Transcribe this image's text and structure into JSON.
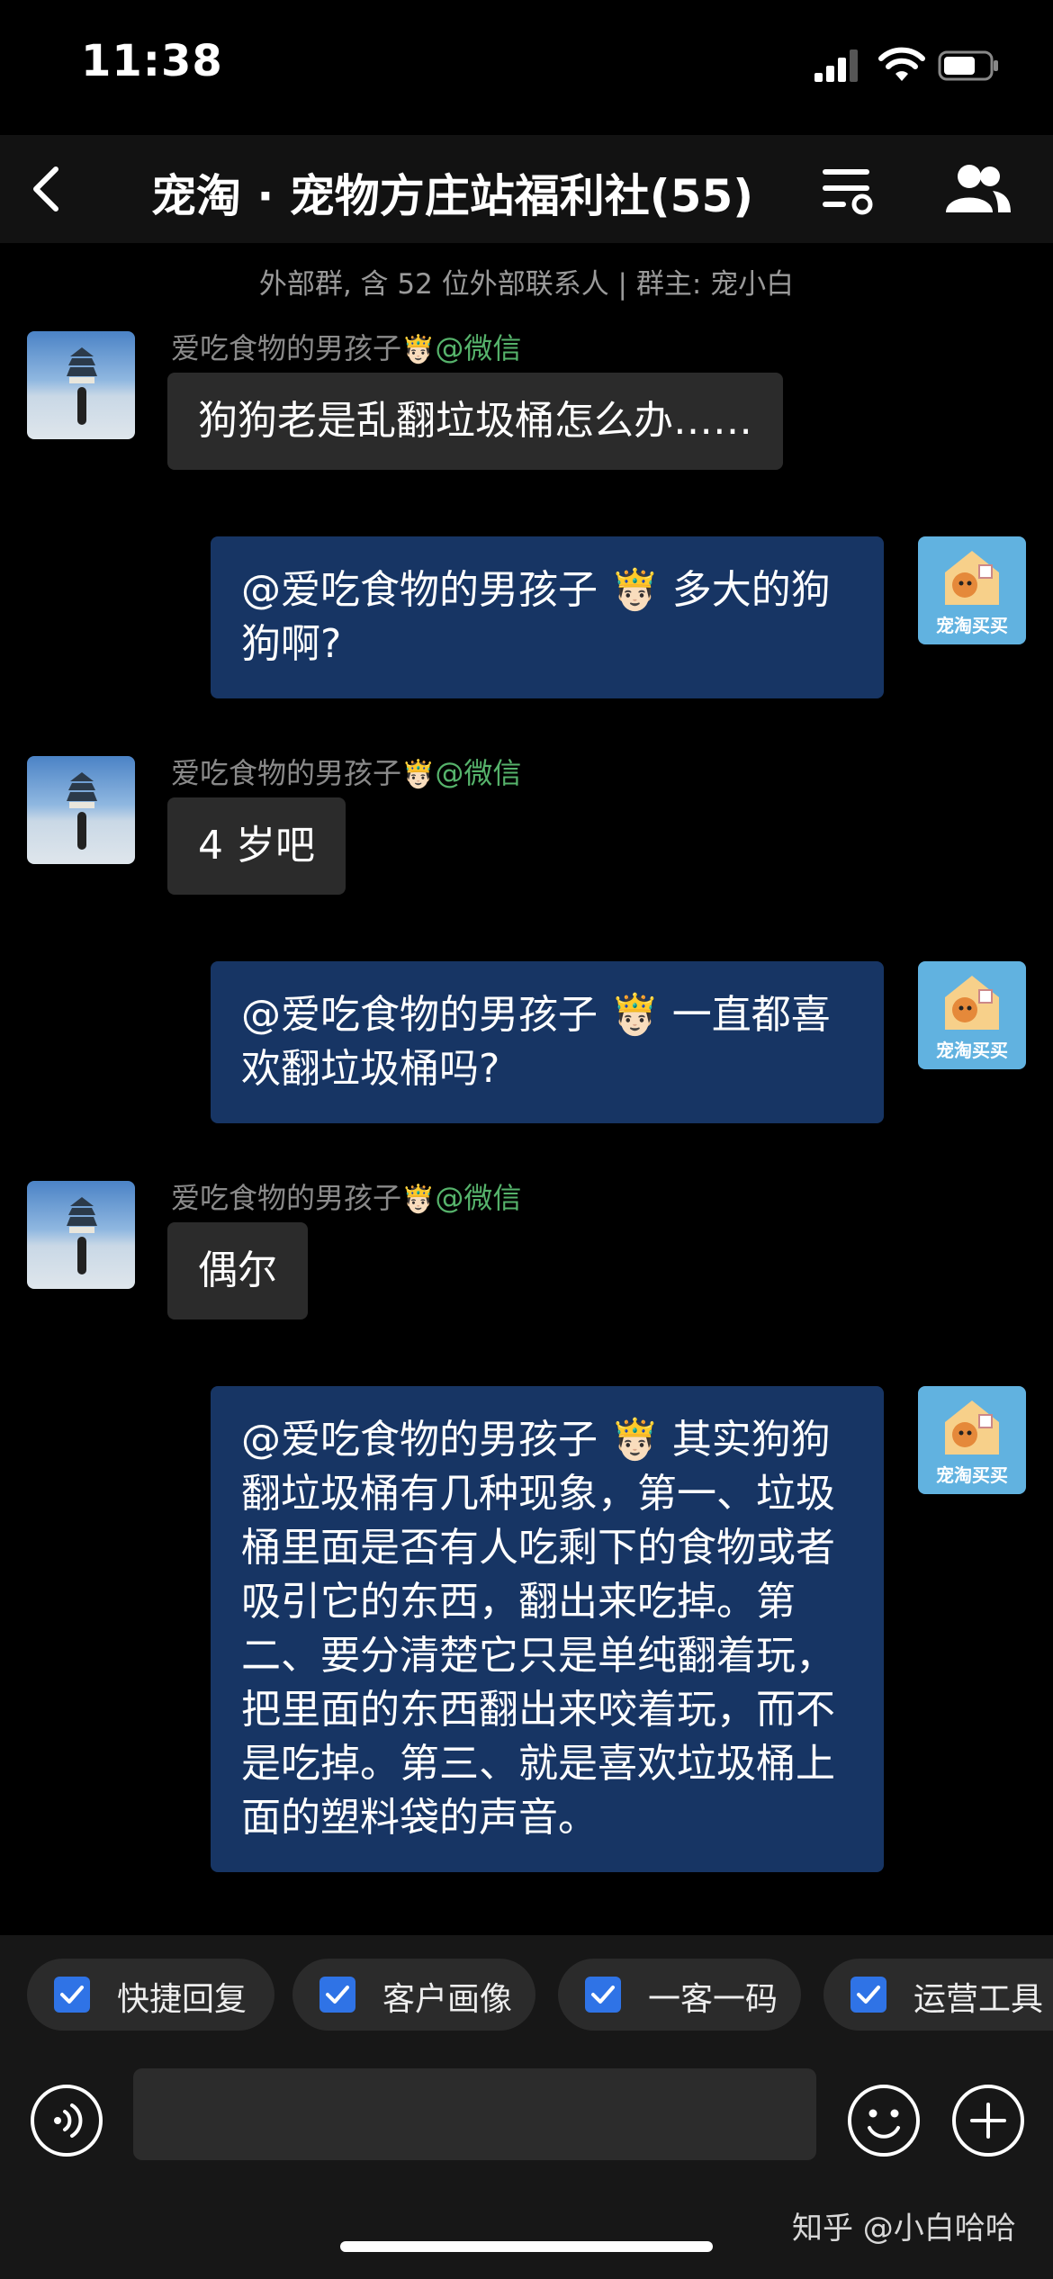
{
  "status_bar": {
    "time": "11:38"
  },
  "nav": {
    "title": "宠淘 · 宠物方庄站福利社(55)"
  },
  "group_info": "外部群, 含 52 位外部联系人 | 群主: 宠小白",
  "sender": {
    "name": "爱吃食物的男孩子",
    "crown": "🤴🏻",
    "source": "@微信"
  },
  "shop_avatar_label": "宠淘买买",
  "messages": [
    {
      "dir": "in",
      "text": "狗狗老是乱翻垃圾桶怎么办……"
    },
    {
      "dir": "out",
      "mention": "@爱吃食物的男孩子 🤴🏻",
      "text": "多大的狗狗啊?"
    },
    {
      "dir": "in",
      "text": "4 岁吧"
    },
    {
      "dir": "out",
      "mention": "@爱吃食物的男孩子 🤴🏻",
      "text": "一直都喜欢翻垃圾桶吗?"
    },
    {
      "dir": "in",
      "text": "偶尔"
    },
    {
      "dir": "out",
      "mention": "@爱吃食物的男孩子 🤴🏻",
      "text": "其实狗狗翻垃圾桶有几种现象，第一、垃圾桶里面是否有人吃剩下的食物或者吸引它的东西，翻出来吃掉。第二、要分清楚它只是单纯翻着玩，把里面的东西翻出来咬着玩，而不是吃掉。第三、就是喜欢垃圾桶上面的塑料袋的声音。"
    }
  ],
  "toolbar": {
    "items": [
      "快捷回复",
      "客户画像",
      "一客一码",
      "运营工具"
    ]
  },
  "watermark": "知乎 @小白哈哈",
  "colors": {
    "incoming_bubble": "#2b2b2b",
    "outgoing_bubble": "#173564",
    "source_green": "#56b36b",
    "check_blue": "#2f73e6"
  }
}
